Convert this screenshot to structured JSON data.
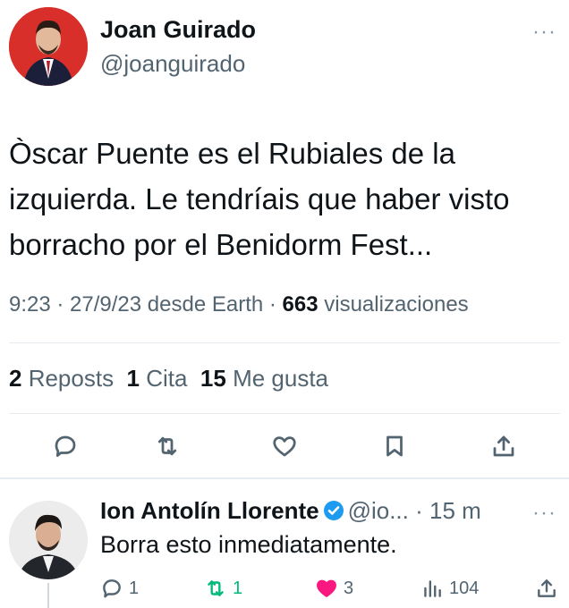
{
  "tweet": {
    "author_name": "Joan Guirado",
    "author_handle": "@joanguirado",
    "more": "···",
    "text": "Òscar Puente es el Rubiales de la izquierda. Le tendríais que haber visto borracho por el Benidorm Fest...",
    "time": "9:23 · 27/9/23 desde Earth · ",
    "views_count": "663",
    "views_label": " visualizaciones",
    "reposts_count": "2",
    "reposts_label": " Reposts  ",
    "quotes_count": "1",
    "quotes_label": " Cita  ",
    "likes_count": "15",
    "likes_label": " Me gusta",
    "icons": [
      "reply-icon",
      "repost-icon",
      "like-icon",
      "bookmark-icon",
      "share-icon"
    ],
    "avatar_color": "#d92f2a"
  },
  "reply": {
    "author_name": "Ion Antolín Llorente",
    "author_handle": "@io...",
    "time": "· 15 m",
    "more": "···",
    "text": "Borra esto inmediatamente.",
    "replies": "1",
    "reposts": "1",
    "likes": "3",
    "views": "104",
    "colors": {
      "repost": "#00ba7c",
      "like": "#f91880",
      "verified": "#1d9bf0"
    }
  }
}
